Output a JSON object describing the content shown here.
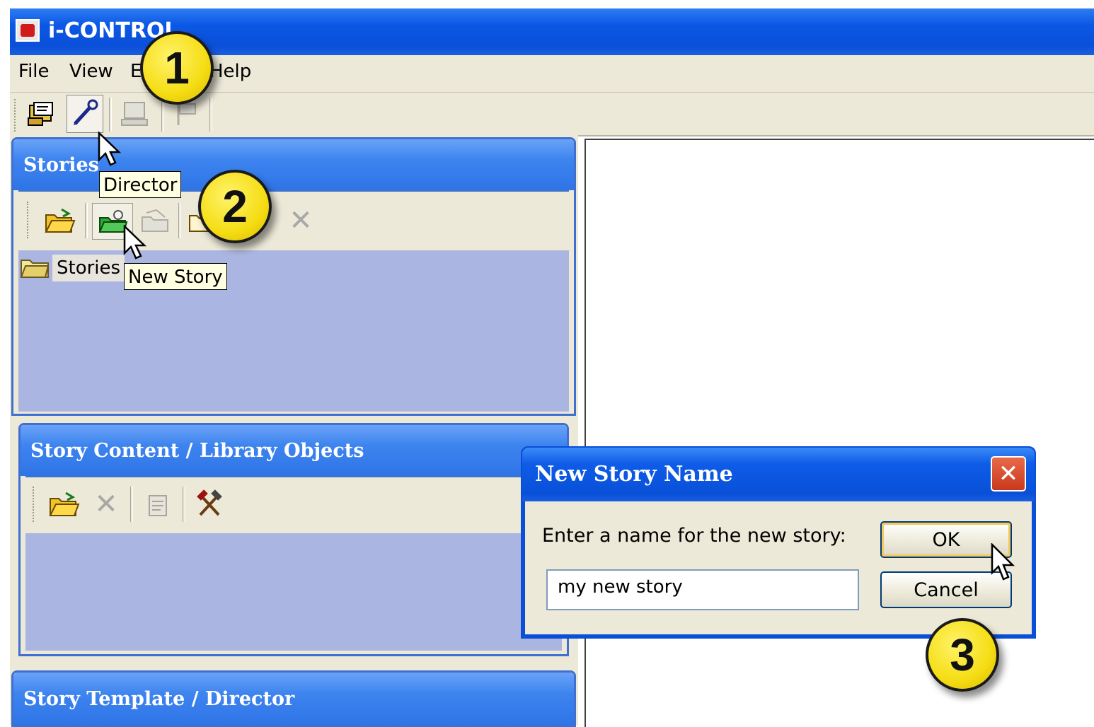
{
  "window": {
    "title": "i-CONTROL"
  },
  "menu": [
    "File",
    "View",
    "E",
    "Help"
  ],
  "tooltips": {
    "director": "Director",
    "new_story": "New Story"
  },
  "stories_panel": {
    "title": "Stories",
    "tree_root": "Stories"
  },
  "content_panel": {
    "title": "Story Content / Library Objects"
  },
  "template_panel": {
    "title": "Story Template / Director"
  },
  "dialog": {
    "title": "New Story Name",
    "close": "✕",
    "prompt": "Enter a name for the new story:",
    "input_value": "my new story",
    "ok_label": "OK",
    "cancel_label": "Cancel"
  },
  "callouts": [
    "1",
    "2",
    "3"
  ],
  "colors": {
    "title_blue": "#0a4fd8",
    "panel_body": "#abb5e1",
    "callout_yellow": "#f5dd14"
  }
}
